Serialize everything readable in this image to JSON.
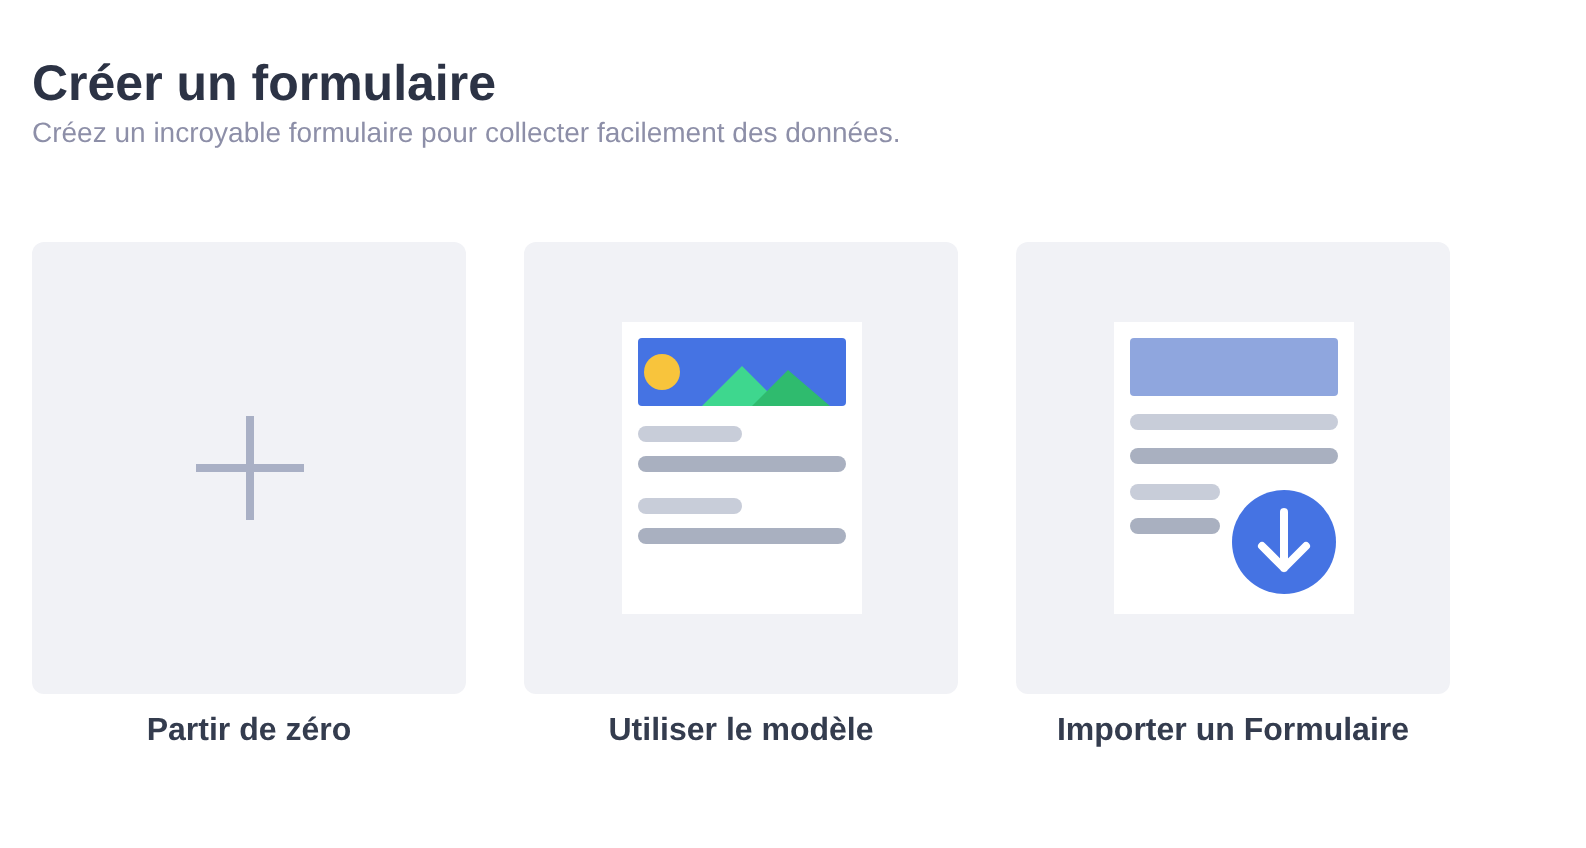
{
  "title": "Créer un formulaire",
  "subtitle": "Créez un incroyable formulaire pour collecter facilement des données.",
  "options": [
    {
      "label": "Partir de zéro",
      "kind": "blank"
    },
    {
      "label": "Utiliser le modèle",
      "kind": "template"
    },
    {
      "label": "Importer un Formulaire",
      "kind": "import"
    }
  ]
}
